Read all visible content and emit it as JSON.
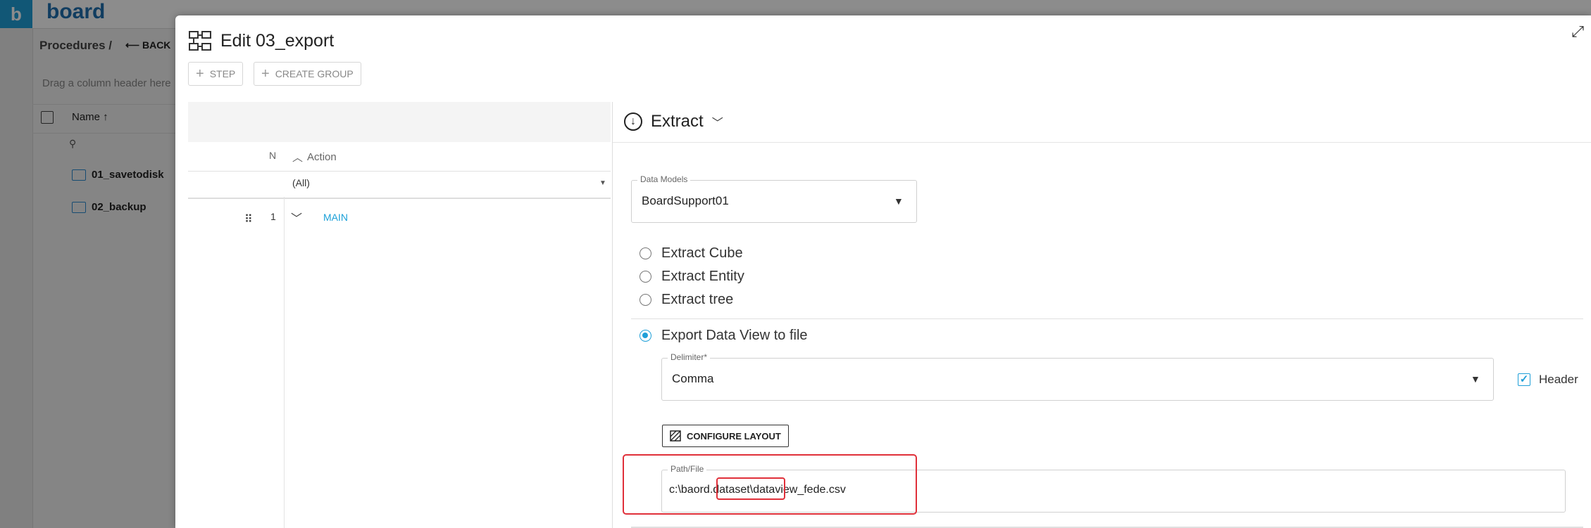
{
  "app": {
    "logo_letter": "b",
    "logo_text": "board"
  },
  "background": {
    "breadcrumb": "Procedures /",
    "back_label": "BACK",
    "drag_hint": "Drag a column header here",
    "name_header": "Name ↑",
    "items": [
      {
        "label": "01_savetodisk"
      },
      {
        "label": "02_backup"
      }
    ]
  },
  "dialog": {
    "title": "Edit 03_export",
    "toolbar": {
      "step_label": "STEP",
      "create_group_label": "CREATE GROUP"
    },
    "grid": {
      "col_n": "N",
      "col_action": "Action",
      "filter_value": "(All)",
      "rows": [
        {
          "n": "1",
          "action": "MAIN"
        }
      ]
    },
    "panel": {
      "title": "Extract",
      "data_models": {
        "label": "Data Models",
        "value": "BoardSupport01"
      },
      "options": [
        {
          "label": "Extract Cube",
          "selected": false
        },
        {
          "label": "Extract Entity",
          "selected": false
        },
        {
          "label": "Extract tree",
          "selected": false
        },
        {
          "label": "Export Data View to file",
          "selected": true
        }
      ],
      "delimiter": {
        "label": "Delimiter*",
        "value": "Comma"
      },
      "header_checkbox": {
        "label": "Header",
        "checked": true
      },
      "configure_layout_label": "CONFIGURE LAYOUT",
      "path": {
        "label": "Path/File",
        "prefix": "c:\\baord.dataset\\",
        "filename": "dataview_fede.csv"
      }
    }
  },
  "colors": {
    "accent": "#1f9fd8",
    "highlight": "#e0303a",
    "link": "#1ba0d8"
  }
}
